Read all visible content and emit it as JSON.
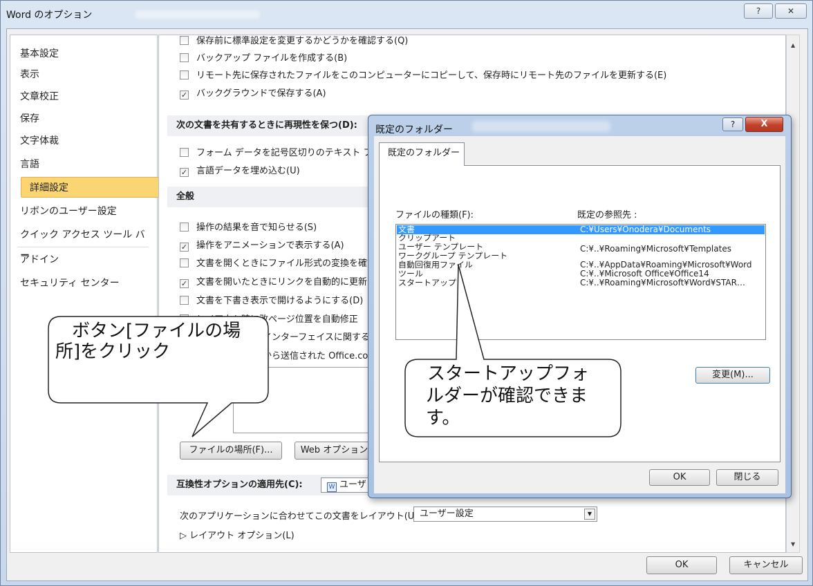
{
  "window": {
    "title": "Word のオプション",
    "help_label": "?",
    "close_label": "✕"
  },
  "sidebar": {
    "items": [
      {
        "label": "基本設定"
      },
      {
        "label": "表示"
      },
      {
        "label": "文章校正"
      },
      {
        "label": "保存"
      },
      {
        "label": "文字体裁"
      },
      {
        "label": "言語"
      },
      {
        "label": "詳細設定"
      },
      {
        "label": "リボンのユーザー設定"
      },
      {
        "label": "クイック アクセス ツール バー"
      },
      {
        "label": "アドイン"
      },
      {
        "label": "セキュリティ センター"
      }
    ],
    "selected": "詳細設定"
  },
  "main": {
    "top_rows": [
      {
        "label": "保存前に標準設定を変更するかどうかを確認する(Q)",
        "checked": false
      },
      {
        "label": "バックアップ ファイルを作成する(B)",
        "checked": false
      },
      {
        "label": "リモート先に保存されたファイルをこのコンピューターにコピーして、保存時にリモート先のファイルを更新する(E)",
        "checked": false
      },
      {
        "label": "バックグラウンドで保存する(A)",
        "checked": true
      }
    ],
    "share_section": "次の文書を共有するときに再現性を保つ(D):",
    "share_rows": [
      {
        "label": "フォーム データを記号区切りのテキスト ファ",
        "checked": false
      },
      {
        "label": "言語データを埋め込む(U)",
        "checked": true
      }
    ],
    "general_section": "全般",
    "general_rows": [
      {
        "label": "操作の結果を音で知らせる(S)",
        "checked": false
      },
      {
        "label": "操作をアニメーションで表示する(A)",
        "checked": true
      },
      {
        "label": "文書を開くときにファイル形式の変換を確認",
        "checked": false
      },
      {
        "label": "文書を開いたときにリンクを自動的に更新す",
        "checked": true
      },
      {
        "label": "文書を下書き表示で開けるようにする(D)",
        "checked": false
      },
      {
        "label": "レイアウト時に改ページ位置を自動修正",
        "checked": false
      },
      {
        "label": "インターフェイスに関するエ",
        "checked": false
      },
      {
        "label": "から送信された Office.co",
        "checked": false
      }
    ],
    "file_location_button": "ファイルの場所(F)...",
    "web_options_button": "Web オプション(",
    "compat_label": "互換性オプションの適用先(C):",
    "compat_value": "ユーザ",
    "layout_label": "次のアプリケーションに合わせてこの文書をレイアウト(U):",
    "layout_value": "ユーザー設定",
    "layout_options_link": "▷ レイアウト オプション(L)"
  },
  "footer": {
    "ok_label": "OK",
    "cancel_label": "キャンセル"
  },
  "dialog": {
    "title": "既定のフォルダー",
    "help_label": "?",
    "close_label": "X",
    "tab_label": "既定のフォルダー",
    "col_type_header": "ファイルの種類(F):",
    "col_path_header": "既定の参照先 :",
    "rows": [
      {
        "type": "文書",
        "path": "C:¥Users¥Onodera¥Documents",
        "selected": true
      },
      {
        "type": "クリップアート",
        "path": ""
      },
      {
        "type": "ユーザー テンプレート",
        "path": "C:¥..¥Roaming¥Microsoft¥Templates"
      },
      {
        "type": "ワークグループ テンプレート",
        "path": ""
      },
      {
        "type": "自動回復用ファイル",
        "path": "C:¥..¥AppData¥Roaming¥Microsoft¥Word"
      },
      {
        "type": "ツール",
        "path": "C:¥..¥Microsoft Office¥Office14"
      },
      {
        "type": "スタートアップ",
        "path": "C:¥..¥Roaming¥Microsoft¥Word¥STAR…"
      }
    ],
    "change_button": "変更(M)...",
    "ok_label": "OK",
    "close_button": "閉じる"
  },
  "callouts": {
    "left_line1": "ボタン[ファイルの場",
    "left_line2": "所]をクリック",
    "right_line1": "スタートアップフォ",
    "right_line2": "ルダーが確認できま",
    "right_line3": "す。"
  },
  "colors": {
    "selected_sidebar": "#fbd571",
    "list_selection": "#3399ff",
    "dialog_close": "#c2412b"
  }
}
